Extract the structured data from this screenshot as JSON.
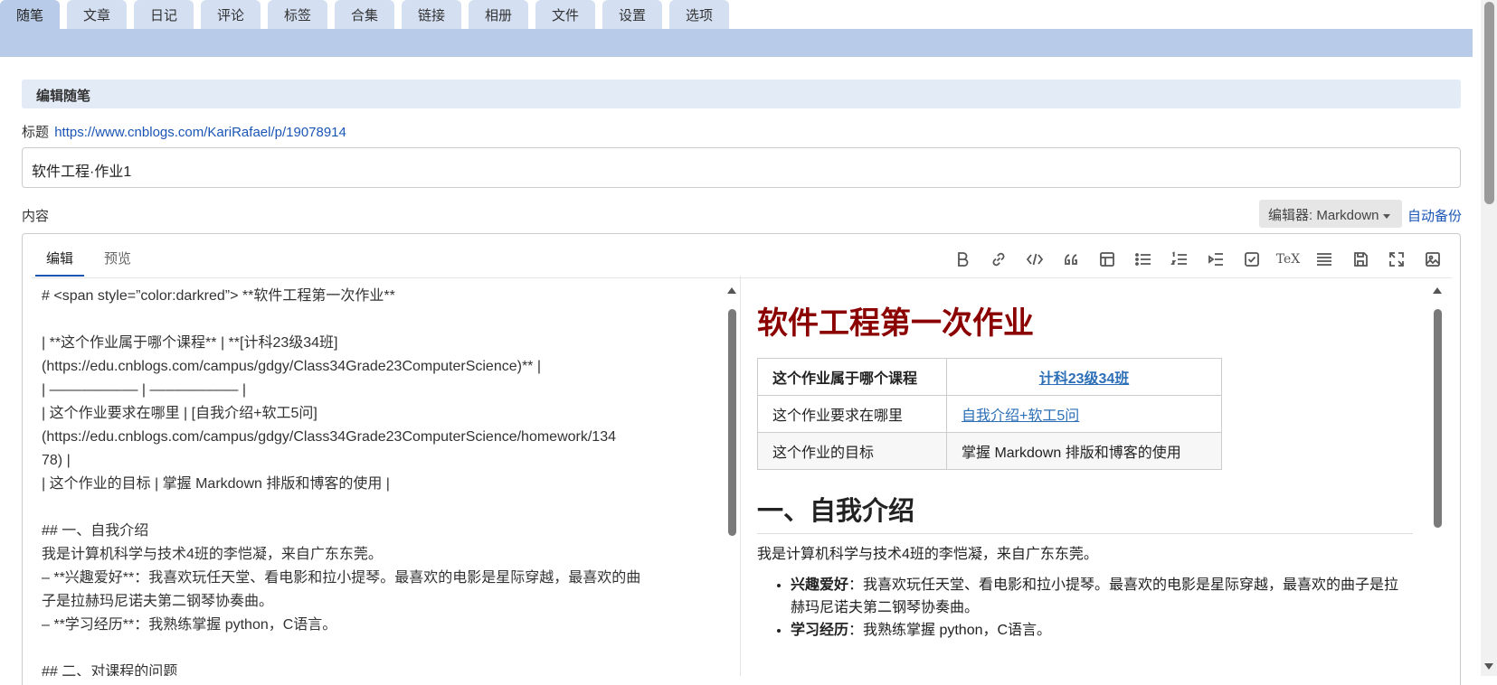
{
  "nav": {
    "tabs": [
      {
        "label": "随笔"
      },
      {
        "label": "文章"
      },
      {
        "label": "日记"
      },
      {
        "label": "评论"
      },
      {
        "label": "标签"
      },
      {
        "label": "合集"
      },
      {
        "label": "链接"
      },
      {
        "label": "相册"
      },
      {
        "label": "文件"
      },
      {
        "label": "设置"
      },
      {
        "label": "选项"
      }
    ],
    "active_index": 0
  },
  "section": {
    "title": "编辑随笔"
  },
  "post": {
    "title_label": "标题",
    "url": "https://www.cnblogs.com/KariRafael/p/19078914",
    "title_value": "软件工程·作业1"
  },
  "content": {
    "label": "内容",
    "editor_select": "编辑器: Markdown",
    "autosave": "自动备份"
  },
  "editor": {
    "tabs": [
      {
        "label": "编辑"
      },
      {
        "label": "预览"
      }
    ],
    "toolbar": [
      {
        "icon": "bold-icon"
      },
      {
        "icon": "link-icon"
      },
      {
        "icon": "code-icon"
      },
      {
        "icon": "quote-icon"
      },
      {
        "icon": "table-icon"
      },
      {
        "icon": "unordered-list-icon"
      },
      {
        "icon": "ordered-list-icon"
      },
      {
        "icon": "indent-icon"
      },
      {
        "icon": "checkbox-icon"
      },
      {
        "icon": "tex-icon",
        "text": "TeX"
      },
      {
        "icon": "horizontal-rule-icon"
      },
      {
        "icon": "save-icon"
      },
      {
        "icon": "fullscreen-icon"
      },
      {
        "icon": "image-icon"
      }
    ],
    "source_lines": [
      "# <span style=”color:darkred”> **软件工程第一次作业**",
      "",
      "| **这个作业属于哪个课程** | **[计科23级34班]",
      "(https://edu.cnblogs.com/campus/gdgy/Class34Grade23ComputerScience)** |",
      "| ––––––––––– | ––––––––––– |",
      "| 这个作业要求在哪里 | [自我介绍+软工5问]",
      "(https://edu.cnblogs.com/campus/gdgy/Class34Grade23ComputerScience/homework/134",
      "78) |",
      "| 这个作业的目标 | 掌握 Markdown 排版和博客的使用 |",
      "",
      "## 一、自我介绍",
      "我是计算机科学与技术4班的李恺凝，来自广东东莞。",
      "– **兴趣爱好**：我喜欢玩任天堂、看电影和拉小提琴。最喜欢的电影是星际穿越，最喜欢的曲",
      "子是拉赫玛尼诺夫第二钢琴协奏曲。",
      "– **学习经历**：我熟练掌握 python，C语言。",
      "",
      "## 二、对课程的问题"
    ]
  },
  "preview": {
    "heading": "软件工程第一次作业",
    "table": [
      {
        "key": "这个作业属于哪个课程",
        "value": "计科23级34班",
        "is_link": true
      },
      {
        "key": "这个作业要求在哪里",
        "value": "自我介绍+软工5问",
        "is_link": true
      },
      {
        "key": "这个作业的目标",
        "value": "掌握 Markdown 排版和博客的使用",
        "is_link": false
      }
    ],
    "section_heading": "一、自我介绍",
    "intro": "我是计算机科学与技术4班的李恺凝，来自广东东莞。",
    "bullets": [
      {
        "label": "兴趣爱好",
        "text": "：我喜欢玩任天堂、看电影和拉小提琴。最喜欢的电影是星际穿越，最喜欢的曲子是拉赫玛尼诺夫第二钢琴协奏曲。"
      },
      {
        "label": "学习经历",
        "text": "：我熟练掌握 python，C语言。"
      }
    ]
  },
  "colors": {
    "accent": "#1a55b5",
    "heading_red": "#8b0000",
    "tab_band": "#b8cbe8"
  }
}
